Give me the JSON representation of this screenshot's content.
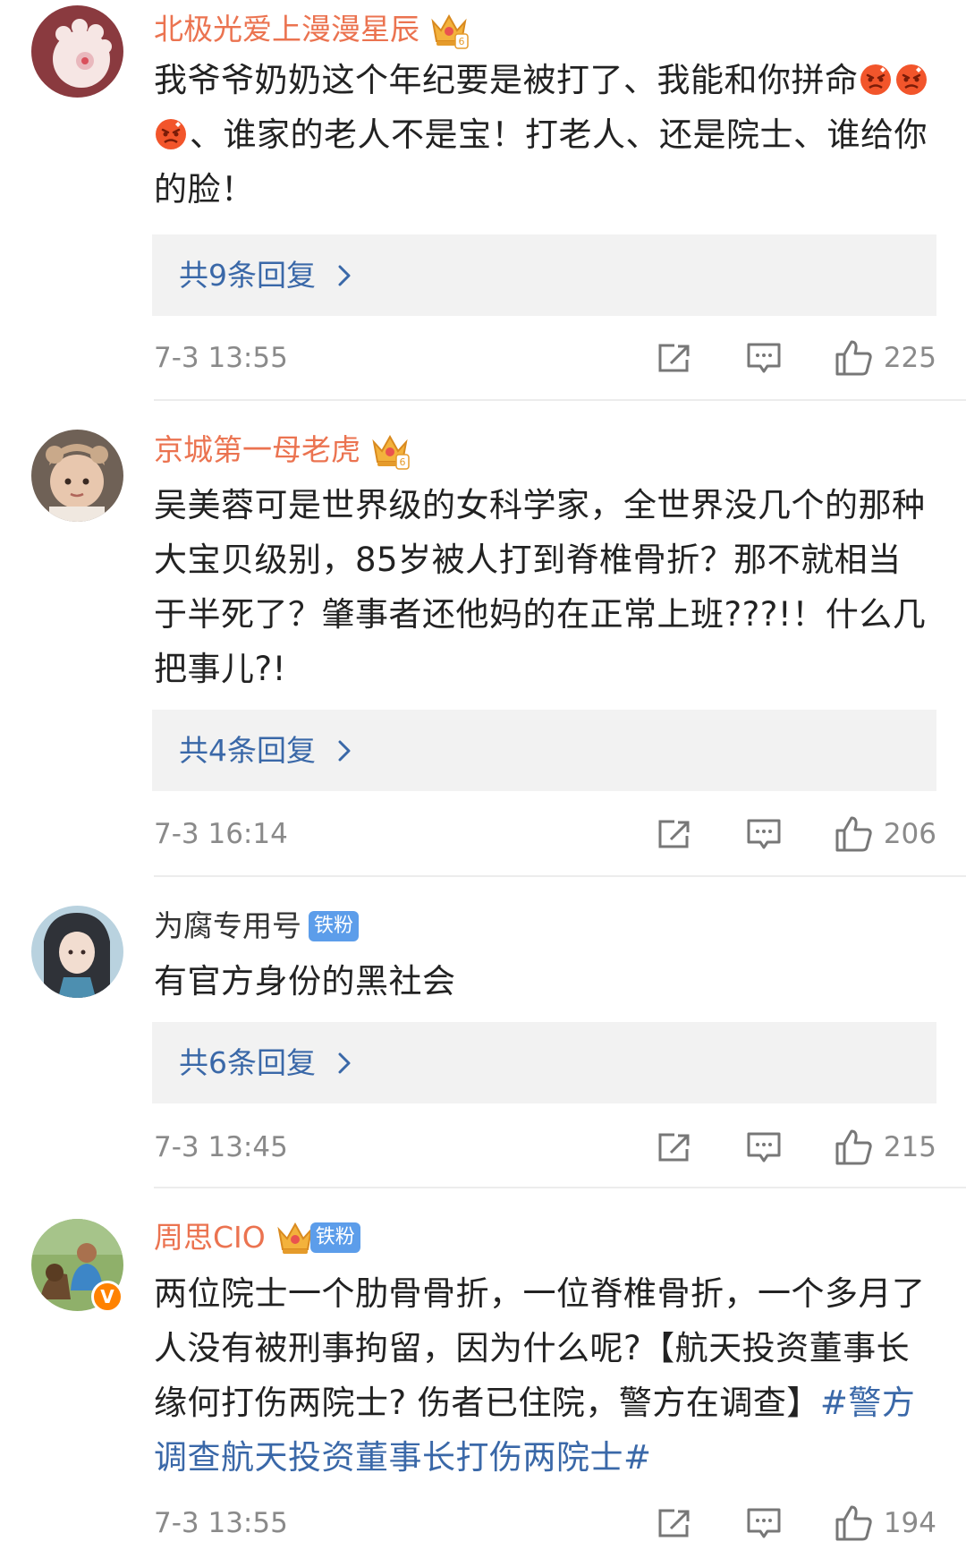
{
  "comments": [
    {
      "username": "北极光爱上漫漫星辰",
      "vip": true,
      "fan_badge": "",
      "verified": false,
      "text_parts": [
        {
          "type": "text",
          "value": "我爷爷奶奶这个年纪要是被打了、我能和你拼命"
        },
        {
          "type": "emoji",
          "value": "angry-face-emoji"
        },
        {
          "type": "emoji",
          "value": "angry-face-emoji"
        },
        {
          "type": "emoji",
          "value": "angry-face-emoji"
        },
        {
          "type": "text",
          "value": "、谁家的老人不是宝！打老人、还是院士、谁给你的脸！"
        }
      ],
      "replies_label": "共9条回复",
      "timestamp": "7-3 13:55",
      "likes": "225"
    },
    {
      "username": "京城第一母老虎",
      "vip": true,
      "fan_badge": "",
      "verified": false,
      "text_parts": [
        {
          "type": "text",
          "value": "吴美蓉可是世界级的女科学家，全世界没几个的那种大宝贝级别，85岁被人打到脊椎骨折？那不就相当于半死了？肇事者还他妈的在正常上班???!！什么几把事儿?!"
        }
      ],
      "replies_label": "共4条回复",
      "timestamp": "7-3 16:14",
      "likes": "206"
    },
    {
      "username": "为腐专用号",
      "vip": false,
      "fan_badge": "铁粉",
      "verified": false,
      "text_parts": [
        {
          "type": "text",
          "value": "有官方身份的黑社会"
        }
      ],
      "replies_label": "共6条回复",
      "timestamp": "7-3 13:45",
      "likes": "215"
    },
    {
      "username": "周思CIO",
      "vip": true,
      "fan_badge": "铁粉",
      "verified": true,
      "verified_mark": "V",
      "text_parts": [
        {
          "type": "text",
          "value": "两位院士一个肋骨骨折，一位脊椎骨折，一个多月了人没有被刑事拘留，因为什么呢?【航天投资董事长缘何打伤两院士? 伤者已住院，警方在调查】"
        },
        {
          "type": "topic",
          "value": "#警方调查航天投资董事长打伤两院士#"
        }
      ],
      "replies_label": "",
      "timestamp": "7-3 13:55",
      "likes": "194"
    }
  ],
  "icons": {
    "share": "share-icon",
    "comment": "comment-icon",
    "like": "thumbs-up-icon",
    "chevron": "chevron-right-icon",
    "crown": "vip-crown-icon"
  },
  "colors": {
    "vip_name": "#eb7350",
    "link": "#3a68a8",
    "reply_bg": "#f2f2f2",
    "meta_gray": "#8a8a8a",
    "fan_badge": "#5c9dea",
    "verified": "#ff8200"
  }
}
